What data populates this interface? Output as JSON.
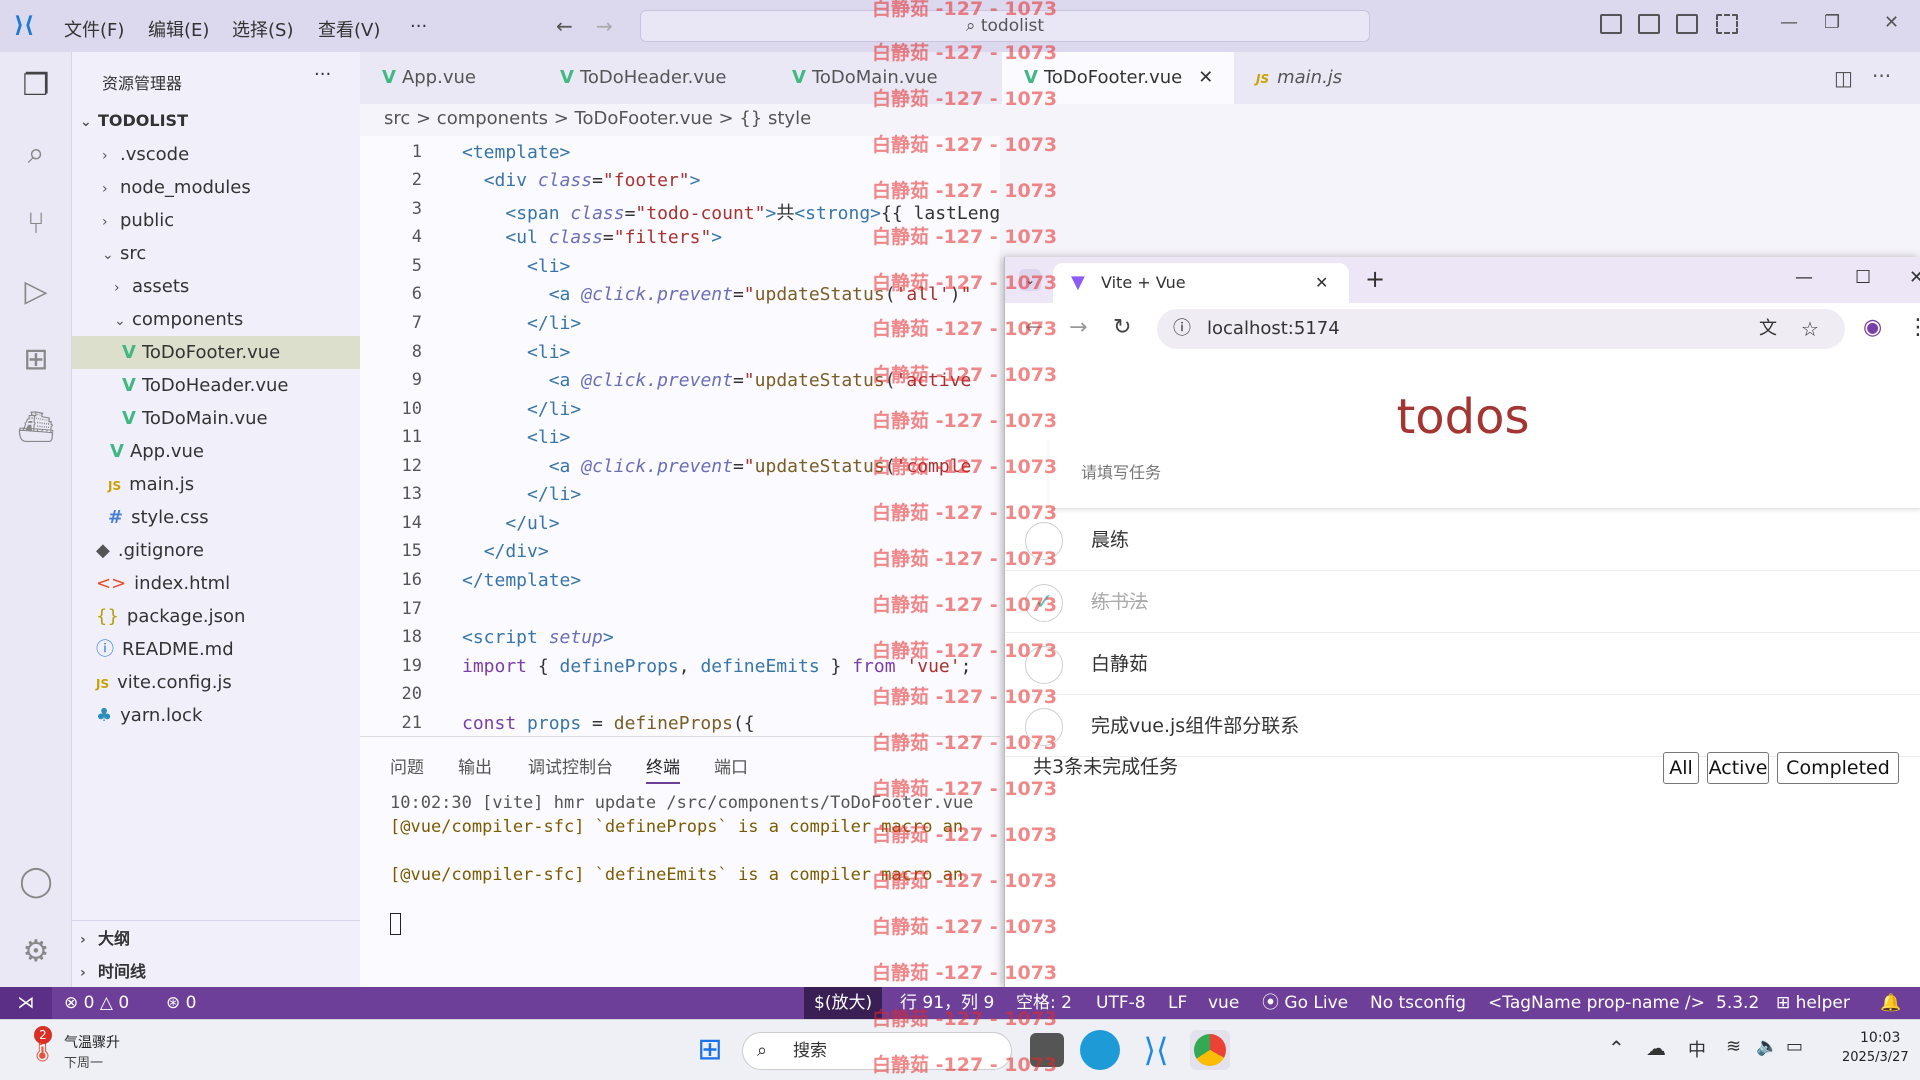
{
  "titlebar": {
    "menus": [
      "文件(F)",
      "编辑(E)",
      "选择(S)",
      "查看(V)",
      "···"
    ],
    "search": "todolist"
  },
  "sidebar": {
    "title": "资源管理器",
    "more": "···",
    "root": "TODOLIST",
    "items": [
      ".vscode",
      "node_modules",
      "public",
      "src",
      "assets",
      "components",
      "ToDoFooter.vue",
      "ToDoHeader.vue",
      "ToDoMain.vue",
      "App.vue",
      "main.js",
      "style.css",
      ".gitignore",
      "index.html",
      "package.json",
      "README.md",
      "vite.config.js",
      "yarn.lock"
    ],
    "outline": "大纲",
    "timeline": "时间线"
  },
  "tabs": [
    "App.vue",
    "ToDoHeader.vue",
    "ToDoMain.vue",
    "ToDoFooter.vue",
    "main.js"
  ],
  "breadcrumb": "src > components > ToDoFooter.vue > {} style",
  "panel": {
    "tabs": [
      "问题",
      "输出",
      "调试控制台",
      "终端",
      "端口"
    ],
    "lines": [
      "10:02:30 [vite] hmr update /src/components/ToDoFooter.vue",
      "[@vue/compiler-sfc] `defineProps` is a compiler macro an",
      "",
      "[@vue/compiler-sfc] `defineEmits` is a compiler macro an"
    ]
  },
  "status": {
    "errors": "0",
    "warnings": "0",
    "ports": "0",
    "zoom": "$(放大)",
    "position": "行 91，列 9",
    "spaces": "空格: 2",
    "encoding": "UTF-8",
    "eol": "LF",
    "lang": "vue",
    "golive": "Go Live",
    "tsconfig": "No tsconfig",
    "tagname": "<TagName prop-name />",
    "version": "5.3.2",
    "helper": "helper"
  },
  "browser": {
    "tab_title": "Vite + Vue",
    "url": "localhost:5174",
    "app_title": "todos",
    "placeholder": "请填写任务",
    "todos": [
      {
        "text": "晨练",
        "done": false
      },
      {
        "text": "练书法",
        "done": true
      },
      {
        "text": "白静茹",
        "done": false
      },
      {
        "text": "完成vue.js组件部分联系",
        "done": false
      }
    ],
    "count": "共3条未完成任务",
    "filters": [
      "All",
      "Active",
      "Completed"
    ]
  },
  "watermark": "白静茹 -127 - 1073",
  "taskbar": {
    "weather_title": "气温骤升",
    "weather_sub": "下周一",
    "badge": "2",
    "search": "搜索",
    "ime": "中",
    "time": "10:03",
    "date": "2025/3/27"
  },
  "colors": {
    "statusbar": "#6d3f99",
    "todos_title": "#a33633",
    "vue_green": "#41b883"
  }
}
